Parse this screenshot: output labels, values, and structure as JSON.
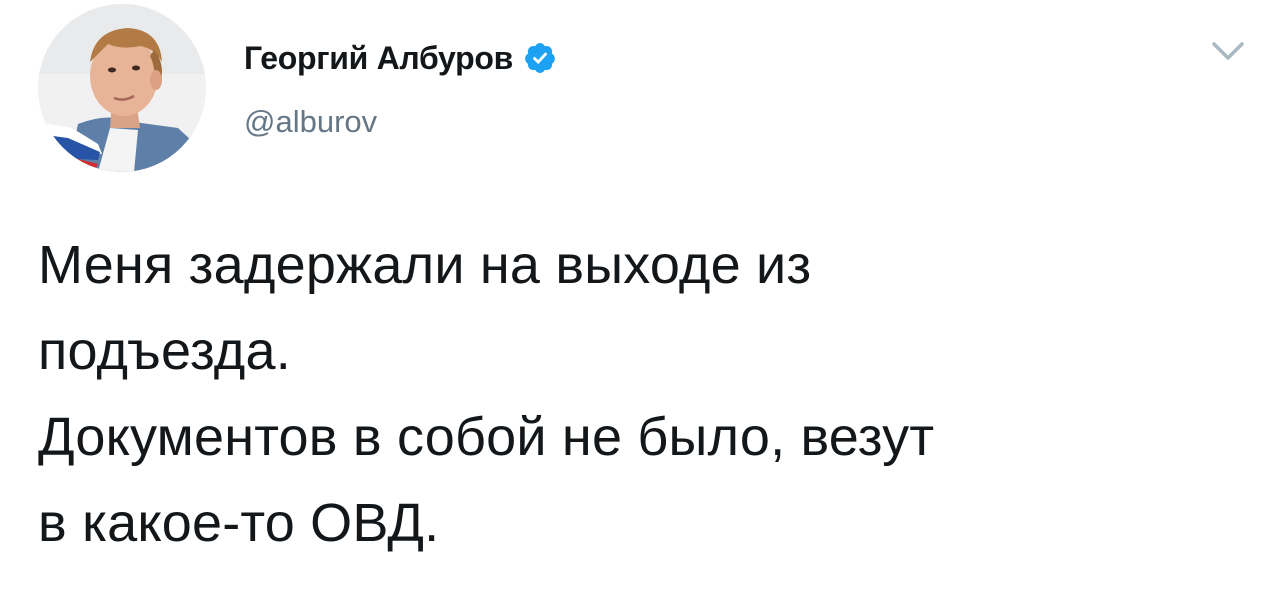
{
  "author": {
    "display_name": "Георгий Албуров",
    "handle": "@alburov",
    "verified": true,
    "avatar_icon": "profile-photo"
  },
  "header": {
    "menu_icon": "chevron-down-icon"
  },
  "tweet": {
    "lines": [
      "Меня задержали на выходе из",
      "подъезда.",
      "Документов в собой не было, везут",
      "в какое-то ОВД."
    ]
  },
  "colors": {
    "text_primary": "#14171a",
    "text_secondary": "#657786",
    "verified_blue": "#1da1f2",
    "chevron_gray": "#aab8c2",
    "background": "#ffffff"
  }
}
